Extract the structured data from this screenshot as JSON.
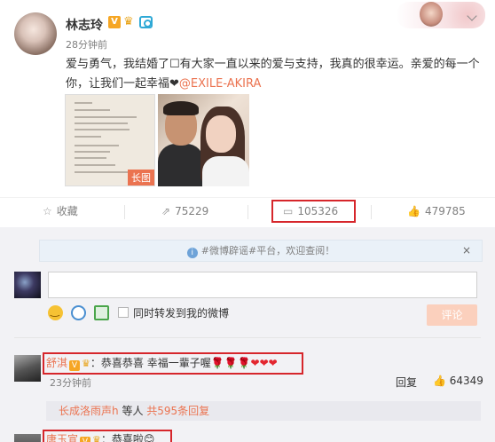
{
  "post": {
    "author": "林志玲",
    "badge_v": "V",
    "time": "28分钟前",
    "text_part1": "爱与勇气，我结婚了☐有大家一直以来的爱与支持，我真的很幸运。亲爱的每一个你，让我们一起幸福❤",
    "mention": "@EXILE-AKIRA",
    "long_image_tag": "长图"
  },
  "actions": {
    "favorite_label": "收藏",
    "repost_count": "75229",
    "comment_count": "105326",
    "like_count": "479785"
  },
  "notice": {
    "text": "#微博辟谣#平台，欢迎查阅！",
    "close": "×"
  },
  "composer": {
    "placeholder": "",
    "repost_label": "同时转发到我的微博",
    "submit_label": "评论"
  },
  "comments": [
    {
      "name": "舒淇",
      "badge_v": "V",
      "text": "：恭喜恭喜 幸福一輩子喔",
      "roses": "🌹🌹🌹",
      "hearts": "❤❤❤",
      "time": "23分钟前",
      "reply_label": "回复",
      "likes": "64349",
      "sub_replies": {
        "user": "长成洛雨声h",
        "middle": "等人",
        "link": "共595条回复"
      }
    },
    {
      "name": "唐玉宣",
      "badge_v": "V",
      "text": "：恭喜啦"
    }
  ],
  "colors": {
    "accent": "#eb7350",
    "highlight_box": "#d6262b",
    "panel_bg": "#f2f2f5"
  }
}
